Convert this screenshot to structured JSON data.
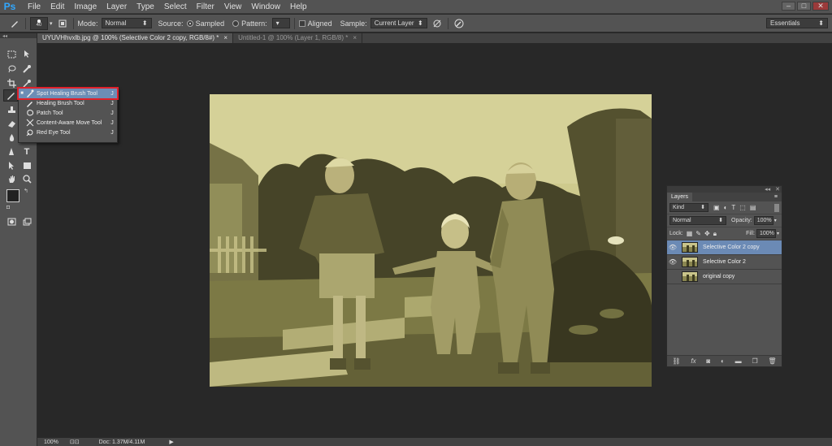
{
  "app": {
    "logo": "Ps"
  },
  "menu": [
    "File",
    "Edit",
    "Image",
    "Layer",
    "Type",
    "Select",
    "Filter",
    "View",
    "Window",
    "Help"
  ],
  "window_controls": {
    "minimize": "–",
    "restore": "□",
    "close": "✕"
  },
  "options": {
    "brush_size": "40",
    "mode_label": "Mode:",
    "mode_value": "Normal",
    "source_label": "Source:",
    "sampled_label": "Sampled",
    "pattern_label": "Pattern:",
    "aligned_label": "Aligned",
    "sample_label": "Sample:",
    "sample_value": "Current Layer",
    "workspace": "Essentials"
  },
  "tabs": [
    {
      "label": "UYUVHhvxlb.jpg @ 100% (Selective Color 2 copy, RGB/8#) *",
      "close": "×"
    },
    {
      "label": "Untitled-1 @ 100% (Layer 1, RGB/8) *",
      "close": "×"
    }
  ],
  "flyout": {
    "items": [
      {
        "label": "Spot Healing Brush Tool",
        "key": "J",
        "selected": true
      },
      {
        "label": "Healing Brush Tool",
        "key": "J",
        "selected": false
      },
      {
        "label": "Patch Tool",
        "key": "J",
        "selected": false
      },
      {
        "label": "Content-Aware Move Tool",
        "key": "J",
        "selected": false
      },
      {
        "label": "Red Eye Tool",
        "key": "J",
        "selected": false
      }
    ]
  },
  "layers_panel": {
    "title": "Layers",
    "kind_label": "Kind",
    "blend_mode": "Normal",
    "opacity_label": "Opacity:",
    "opacity_value": "100%",
    "lock_label": "Lock:",
    "fill_label": "Fill:",
    "fill_value": "100%",
    "layers": [
      {
        "name": "Selective Color 2 copy",
        "visible": true,
        "selected": true
      },
      {
        "name": "Selective Color 2",
        "visible": true,
        "selected": false
      },
      {
        "name": "original copy",
        "visible": false,
        "selected": false
      }
    ]
  },
  "status": {
    "zoom": "100%",
    "doc": "Doc: 1.37M/4.11M"
  },
  "colors": {
    "accent_selected": "#6b8ab5",
    "highlight_outline": "#e0202a",
    "photo_tint": "#c9c48a"
  }
}
